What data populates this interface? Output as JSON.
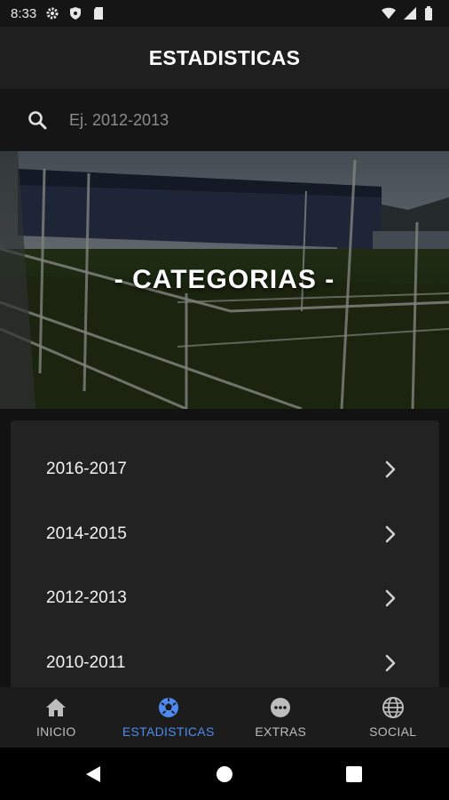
{
  "status_bar": {
    "time": "8:33"
  },
  "app_bar": {
    "title": "ESTADISTICAS"
  },
  "search": {
    "placeholder": "Ej. 2012-2013",
    "value": ""
  },
  "banner": {
    "title": "- CATEGORIAS -"
  },
  "seasons": [
    {
      "label": "2016-2017"
    },
    {
      "label": "2014-2015"
    },
    {
      "label": "2012-2013"
    },
    {
      "label": "2010-2011"
    }
  ],
  "bottom_nav": {
    "items": [
      {
        "label": "INICIO",
        "icon": "home-icon"
      },
      {
        "label": "ESTADISTICAS",
        "icon": "soccer-ball-icon",
        "active": true
      },
      {
        "label": "EXTRAS",
        "icon": "more-icon"
      },
      {
        "label": "SOCIAL",
        "icon": "globe-icon"
      }
    ]
  },
  "colors": {
    "accent": "#4d8bf0",
    "background": "#121212",
    "card": "#222222"
  }
}
